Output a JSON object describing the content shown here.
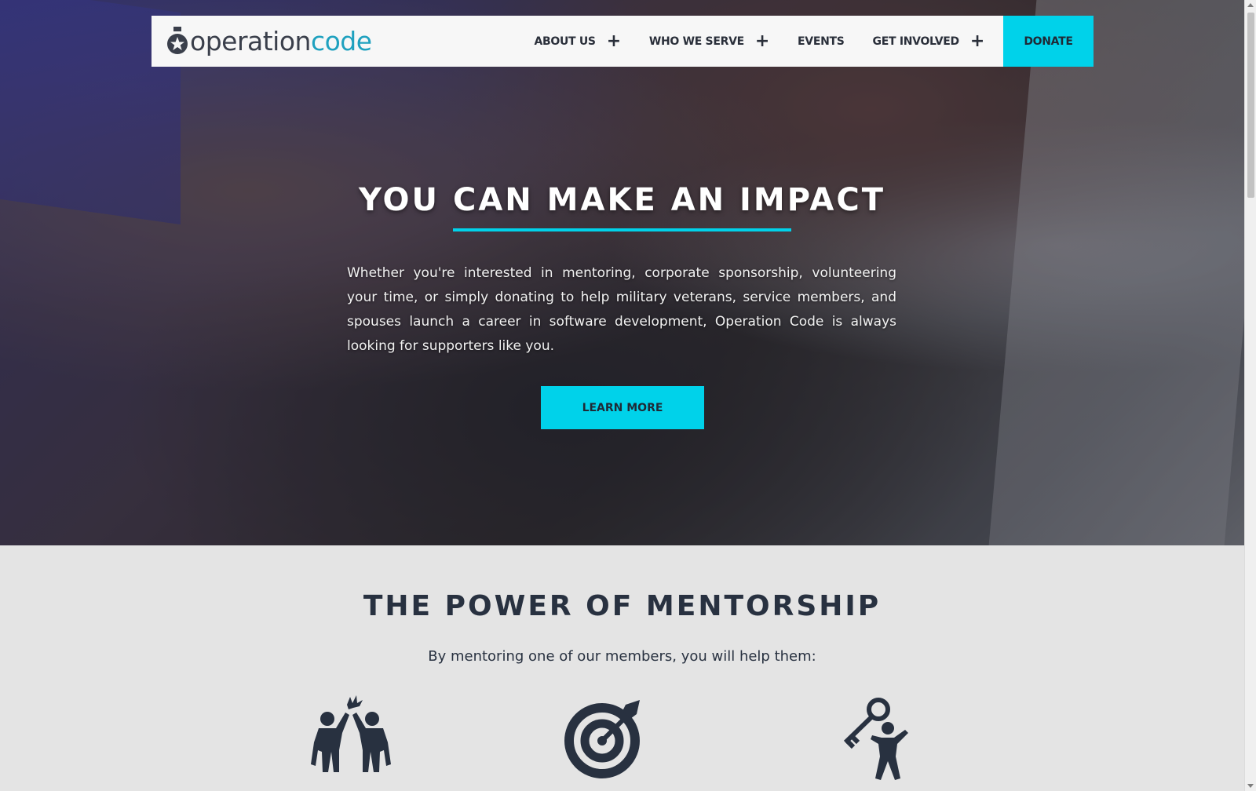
{
  "brand": {
    "logo_part1": "operation",
    "logo_part2": "code",
    "accent_color": "#00d2ea",
    "logo_color": "#1fa1bf"
  },
  "nav": {
    "items": [
      {
        "label": "ABOUT US",
        "has_submenu": true
      },
      {
        "label": "WHO WE SERVE",
        "has_submenu": true
      },
      {
        "label": "EVENTS",
        "has_submenu": false
      },
      {
        "label": "GET INVOLVED",
        "has_submenu": true
      }
    ],
    "plus_symbol": "+",
    "donate_label": "DONATE"
  },
  "hero": {
    "title": "YOU CAN MAKE AN IMPACT",
    "body": "Whether you're interested in mentoring, corporate sponsorship, volunteering your time, or simply donating to help military veterans, service members, and spouses launch a career in software development, Operation Code is always looking for supporters like you.",
    "cta_label": "LEARN MORE"
  },
  "mentorship": {
    "title": "THE POWER OF MENTORSHIP",
    "subtitle": "By mentoring one of our members, you will help them:",
    "icons": [
      "high-five-icon",
      "target-icon",
      "key-person-icon"
    ]
  }
}
